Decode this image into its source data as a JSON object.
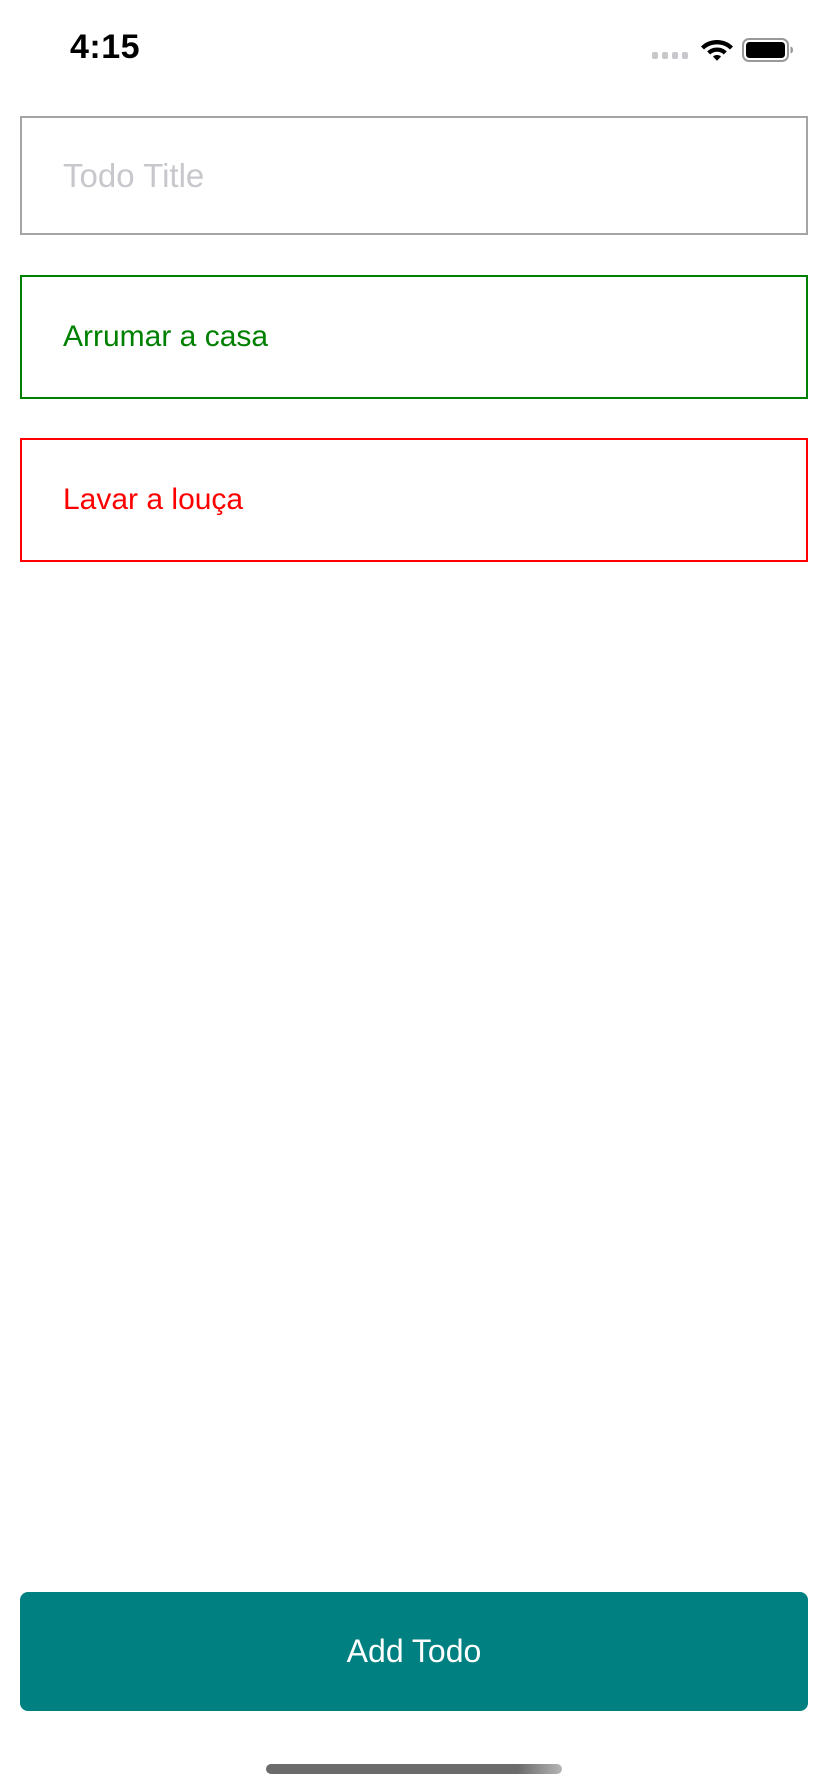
{
  "status_bar": {
    "time": "4:15"
  },
  "new_todo": {
    "placeholder": "Todo Title",
    "value": ""
  },
  "todos": [
    {
      "title": "Arrumar a casa",
      "status": "done",
      "color": "#008000"
    },
    {
      "title": "Lavar a louça",
      "status": "pending",
      "color": "#ff0000"
    }
  ],
  "actions": {
    "add_label": "Add Todo"
  },
  "colors": {
    "accent": "#008080",
    "done": "#008000",
    "pending": "#ff0000",
    "input_border": "#a5a5a5",
    "placeholder": "#c7c7cc"
  }
}
